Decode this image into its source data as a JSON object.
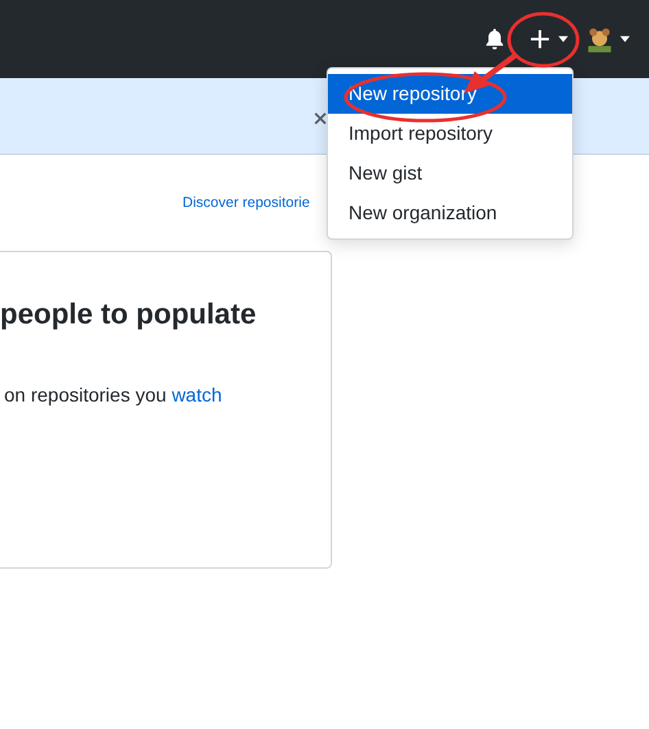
{
  "discover_link": "Discover repositorie",
  "card": {
    "heading": "people to populate",
    "text": "on repositories you ",
    "text_link": "watch"
  },
  "new_menu": [
    {
      "label": "New repository",
      "selected": true
    },
    {
      "label": "Import repository",
      "selected": false
    },
    {
      "label": "New gist",
      "selected": false
    },
    {
      "label": "New organization",
      "selected": false
    }
  ],
  "annotations": [
    {
      "kind": "ellipse"
    },
    {
      "kind": "ellipse"
    },
    {
      "kind": "arrow"
    }
  ]
}
